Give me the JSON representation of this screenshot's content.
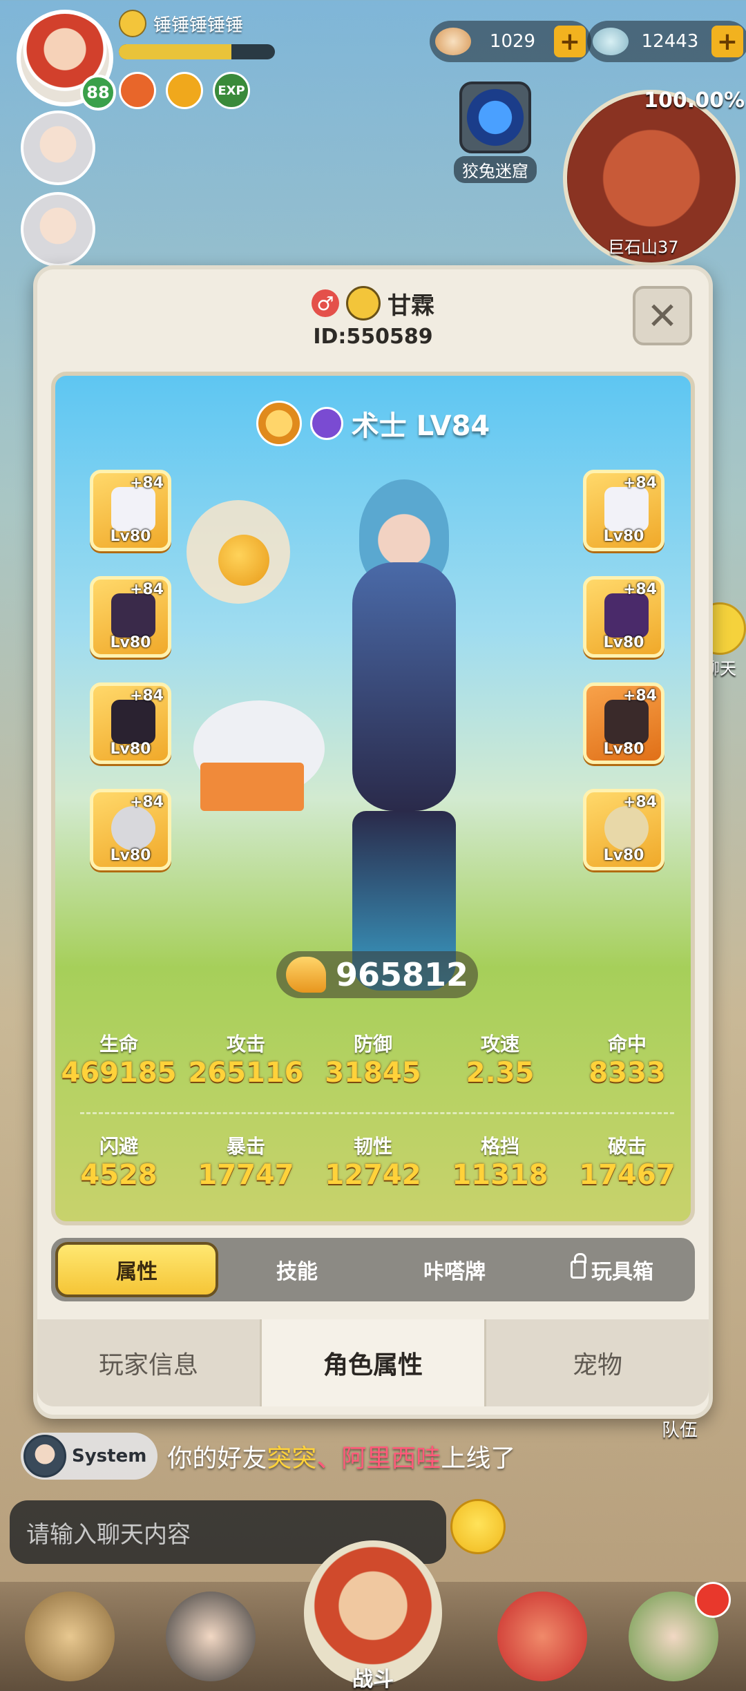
{
  "player": {
    "name": "锤锤锤锤锤",
    "level": "88",
    "exp_fraction": 0.72,
    "badges": [
      "fire-badge",
      "gold-badge",
      "exp-badge"
    ],
    "exp_badge_label": "EXP"
  },
  "currencies": [
    {
      "icon": "bread-icon",
      "value": "1029"
    },
    {
      "icon": "gem-icon",
      "value": "12443"
    }
  ],
  "dungeon": {
    "label": "狡兔迷窟"
  },
  "minimap": {
    "percent": "100.00%",
    "location": "巨石山37"
  },
  "side_chat": {
    "label": "聊天"
  },
  "modal": {
    "gender_icon": "male-icon",
    "name": "甘霖",
    "id_text": "ID:550589",
    "class_text": "术士 LV84",
    "power": "965812",
    "equip_left": [
      {
        "plus": "+84",
        "lv": "Lv80",
        "icon": "staff-icon"
      },
      {
        "plus": "+84",
        "lv": "Lv80",
        "icon": "gauntlet-icon"
      },
      {
        "plus": "+84",
        "lv": "Lv80",
        "icon": "hat-icon"
      },
      {
        "plus": "+84",
        "lv": "Lv80",
        "icon": "ring-icon"
      }
    ],
    "equip_right": [
      {
        "plus": "+84",
        "lv": "Lv80",
        "icon": "wand-icon"
      },
      {
        "plus": "+84",
        "lv": "Lv80",
        "icon": "cloak-icon"
      },
      {
        "plus": "+84",
        "lv": "Lv80",
        "icon": "boots-icon"
      },
      {
        "plus": "+84",
        "lv": "Lv80",
        "icon": "necklace-icon"
      }
    ],
    "stats_row1": [
      {
        "label": "生命",
        "value": "469185"
      },
      {
        "label": "攻击",
        "value": "265116"
      },
      {
        "label": "防御",
        "value": "31845"
      },
      {
        "label": "攻速",
        "value": "2.35"
      },
      {
        "label": "命中",
        "value": "8333"
      }
    ],
    "stats_row2": [
      {
        "label": "闪避",
        "value": "4528"
      },
      {
        "label": "暴击",
        "value": "17747"
      },
      {
        "label": "韧性",
        "value": "12742"
      },
      {
        "label": "格挡",
        "value": "11318"
      },
      {
        "label": "破击",
        "value": "17467"
      }
    ],
    "subtabs": [
      {
        "label": "属性",
        "active": true
      },
      {
        "label": "技能",
        "active": false
      },
      {
        "label": "咔嗒牌",
        "active": false
      },
      {
        "label": "玩具箱",
        "active": false,
        "locked": true
      }
    ],
    "maintabs": [
      {
        "label": "玩家信息",
        "active": false
      },
      {
        "label": "角色属性",
        "active": true
      },
      {
        "label": "宠物",
        "active": false
      }
    ]
  },
  "chat": {
    "sys_name": "System",
    "msg_prefix": "你的好友",
    "msg_friend1": "突突",
    "msg_sep": "、",
    "msg_friend2": "阿里西哇",
    "msg_suffix": "上线了",
    "input_placeholder": "请输入聊天内容"
  },
  "team_label": "队伍",
  "bottom_nav": {
    "battle_label": "战斗"
  },
  "colors": {
    "accent_gold": "#ffd23a",
    "panel_bg": "#f1ece1",
    "tab_active": "#f5c536"
  }
}
